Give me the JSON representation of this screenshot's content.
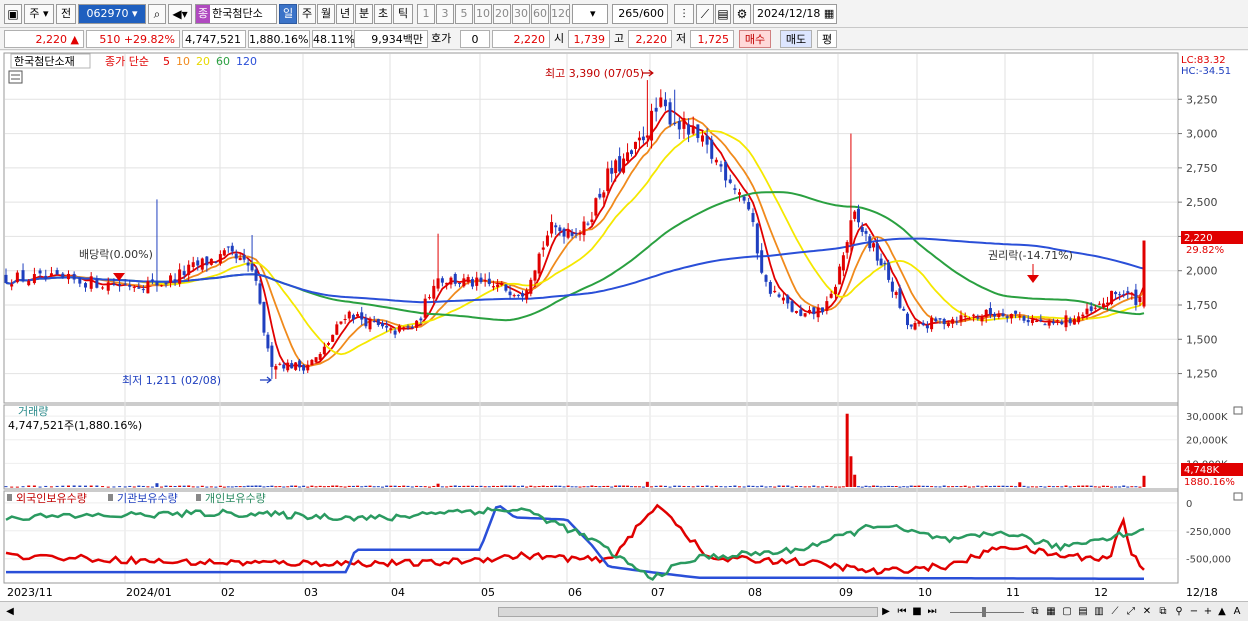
{
  "toolbar": {
    "market": "주",
    "period_type": "전",
    "code": "062970",
    "stock_name": "한국첨단소",
    "stock_badge": "종",
    "periods": [
      "일",
      "주",
      "월",
      "년",
      "분",
      "초",
      "틱"
    ],
    "active_period": "일",
    "intervals": [
      "1",
      "3",
      "5",
      "10",
      "20",
      "30",
      "60",
      "120"
    ],
    "count": "265",
    "count_max": "/600",
    "date": "2024/12/18"
  },
  "quote": {
    "price": "2,220",
    "change": "510",
    "change_pct": "+29.82%",
    "volume": "4,747,521",
    "volume_pct": "1,880.16%",
    "turnover_pct": "48.11%",
    "amount": "9,934백만",
    "hoga_label": "호가",
    "hoga_value": "0",
    "hoga_price": "2,220",
    "open_label": "시",
    "open": "1,739",
    "high_label": "고",
    "high": "2,220",
    "low_label": "저",
    "low": "1,725",
    "buy_label": "매수",
    "sell_label": "매도",
    "avg_label": "평"
  },
  "price_panel": {
    "title": "한국첨단소재",
    "legend_prefix": "종가 단순",
    "ma_labels": [
      "5",
      "10",
      "20",
      "60",
      "120"
    ],
    "lc": "LC:83.32",
    "hc": "HC:-34.51",
    "current_tag": "2,220",
    "current_pct": "29.82%",
    "ann_high": "최고 3,390 (07/05)",
    "ann_low": "최저 1,211 (02/08)",
    "ann_div": "배당락(0.00%)",
    "ann_rights": "권리락(-14.71%)"
  },
  "volume_panel": {
    "title": "거래량",
    "value": "4,747,521주(1,880.16%)",
    "tag": "4,748K",
    "tag_pct": "1880.16%"
  },
  "holding_panel": {
    "labels": [
      "외국인보유수량",
      "기관보유수량",
      "개인보유수량"
    ]
  },
  "x_axis": {
    "labels": [
      "2023/11",
      "2024/01",
      "02",
      "03",
      "04",
      "05",
      "06",
      "07",
      "08",
      "09",
      "10",
      "11",
      "12"
    ],
    "end_label": "12/18"
  },
  "colors": {
    "up": "#e00000",
    "down": "#1f3fbf",
    "ma5": "#e00000",
    "ma10": "#f08a1c",
    "ma20": "#f5e800",
    "ma60": "#2aa040",
    "ma120": "#2a4fd8",
    "holding_foreign": "#e00000",
    "holding_inst": "#2a4fd8",
    "holding_indiv": "#2a9a60"
  },
  "chart_data": [
    {
      "type": "candlestick",
      "title": "한국첨단소재",
      "yticks": [
        1250,
        1500,
        1750,
        2000,
        2250,
        2500,
        2750,
        3000,
        3250
      ],
      "ylim": [
        1050,
        3500
      ],
      "grid": true,
      "x_months": [
        "2023/11",
        "2024/01",
        "02",
        "03",
        "04",
        "05",
        "06",
        "07",
        "08",
        "09",
        "10",
        "11",
        "12"
      ],
      "close_anchors": [
        {
          "m": 0.0,
          "v": 1950
        },
        {
          "m": 0.5,
          "v": 1930
        },
        {
          "m": 1.0,
          "v": 1900
        },
        {
          "m": 1.4,
          "v": 1910
        },
        {
          "m": 1.8,
          "v": 2050
        },
        {
          "m": 2.1,
          "v": 2120
        },
        {
          "m": 2.4,
          "v": 2000
        },
        {
          "m": 2.6,
          "v": 1330
        },
        {
          "m": 3.0,
          "v": 1300
        },
        {
          "m": 3.2,
          "v": 1380
        },
        {
          "m": 3.5,
          "v": 1700
        },
        {
          "m": 4.0,
          "v": 1550
        },
        {
          "m": 4.3,
          "v": 1600
        },
        {
          "m": 4.5,
          "v": 1950
        },
        {
          "m": 5.0,
          "v": 1900
        },
        {
          "m": 5.5,
          "v": 1850
        },
        {
          "m": 5.8,
          "v": 2300
        },
        {
          "m": 6.2,
          "v": 2300
        },
        {
          "m": 6.5,
          "v": 2700
        },
        {
          "m": 6.8,
          "v": 2850
        },
        {
          "m": 7.1,
          "v": 3200
        },
        {
          "m": 7.5,
          "v": 2950
        },
        {
          "m": 7.8,
          "v": 2700
        },
        {
          "m": 8.0,
          "v": 2500
        },
        {
          "m": 8.2,
          "v": 1900
        },
        {
          "m": 8.6,
          "v": 1650
        },
        {
          "m": 8.9,
          "v": 1750
        },
        {
          "m": 9.2,
          "v": 2400
        },
        {
          "m": 9.6,
          "v": 2000
        },
        {
          "m": 9.9,
          "v": 1580
        },
        {
          "m": 10.4,
          "v": 1650
        },
        {
          "m": 11.0,
          "v": 1700
        },
        {
          "m": 11.5,
          "v": 1600
        },
        {
          "m": 12.0,
          "v": 1700
        },
        {
          "m": 12.3,
          "v": 1850
        },
        {
          "m": 12.55,
          "v": 1780
        },
        {
          "m": 12.6,
          "v": 2220
        }
      ],
      "spikes": [
        {
          "m": 1.35,
          "high": 2520
        },
        {
          "m": 2.4,
          "high": 2260
        },
        {
          "m": 4.55,
          "high": 2270
        },
        {
          "m": 6.98,
          "high": 3390
        },
        {
          "m": 7.25,
          "high": 3320
        },
        {
          "m": 9.15,
          "high": 3000
        },
        {
          "m": 12.6,
          "high": 2220
        }
      ],
      "low_point": {
        "m": 2.65,
        "v": 1211
      },
      "high_point": {
        "m": 7.05,
        "v": 3390
      },
      "last": {
        "open": 1739,
        "high": 2220,
        "low": 1725,
        "close": 2220
      },
      "moving_averages": [
        "5",
        "10",
        "20",
        "60",
        "120"
      ]
    },
    {
      "type": "bar",
      "title": "거래량",
      "yticks": [
        10000,
        20000,
        30000
      ],
      "ytick_labels": [
        "10,000K",
        "20,000K",
        "30,000K"
      ],
      "ylim": [
        0,
        33000
      ],
      "spikes": [
        {
          "m": 1.35,
          "v": 1600
        },
        {
          "m": 4.55,
          "v": 1400
        },
        {
          "m": 6.95,
          "v": 2200
        },
        {
          "m": 9.1,
          "v": 31000
        },
        {
          "m": 9.15,
          "v": 13000
        },
        {
          "m": 9.2,
          "v": 5200
        },
        {
          "m": 11.15,
          "v": 2000
        },
        {
          "m": 12.6,
          "v": 4748
        }
      ],
      "last_value_k": 4748
    },
    {
      "type": "line",
      "title": "보유수량",
      "yticks": [
        0,
        -250000,
        -500000
      ],
      "ytick_labels": [
        "0",
        "-250,000",
        "-500,000"
      ],
      "ylim": [
        -700000,
        80000
      ],
      "series": [
        {
          "name": "외국인보유수량",
          "anchors": [
            [
              0,
              -470000
            ],
            [
              1.5,
              -530000
            ],
            [
              3,
              -540000
            ],
            [
              4.5,
              -540000
            ],
            [
              5.5,
              -470000
            ],
            [
              6.5,
              -520000
            ],
            [
              7.1,
              -10000
            ],
            [
              7.6,
              -500000
            ],
            [
              8.5,
              -520000
            ],
            [
              9.5,
              -620000
            ],
            [
              10.4,
              -560000
            ],
            [
              11,
              -380000
            ],
            [
              11.6,
              -470000
            ],
            [
              12.2,
              -500000
            ],
            [
              12.35,
              -120000
            ],
            [
              12.45,
              -460000
            ],
            [
              12.6,
              -580000
            ]
          ]
        },
        {
          "name": "기관보유수량",
          "anchors": [
            [
              0,
              -620000
            ],
            [
              2,
              -620000
            ],
            [
              3.5,
              -620000
            ],
            [
              3.6,
              -420000
            ],
            [
              4.3,
              -420000
            ],
            [
              5.0,
              -420000
            ],
            [
              5.2,
              -10000
            ],
            [
              5.4,
              -130000
            ],
            [
              6.0,
              -150000
            ],
            [
              6.3,
              -380000
            ],
            [
              6.5,
              -570000
            ],
            [
              7.5,
              -670000
            ],
            [
              9,
              -670000
            ],
            [
              10,
              -675000
            ],
            [
              12.6,
              -680000
            ]
          ]
        },
        {
          "name": "개인보유수량",
          "anchors": [
            [
              0,
              -130000
            ],
            [
              2,
              -90000
            ],
            [
              4,
              -140000
            ],
            [
              4.5,
              -80000
            ],
            [
              5.5,
              -60000
            ],
            [
              6.3,
              -330000
            ],
            [
              7.0,
              -670000
            ],
            [
              7.5,
              -490000
            ],
            [
              8.5,
              -430000
            ],
            [
              9.5,
              -190000
            ],
            [
              10.4,
              -340000
            ],
            [
              11,
              -260000
            ],
            [
              11.6,
              -400000
            ],
            [
              12.2,
              -300000
            ],
            [
              12.6,
              -250000
            ]
          ]
        }
      ]
    }
  ]
}
